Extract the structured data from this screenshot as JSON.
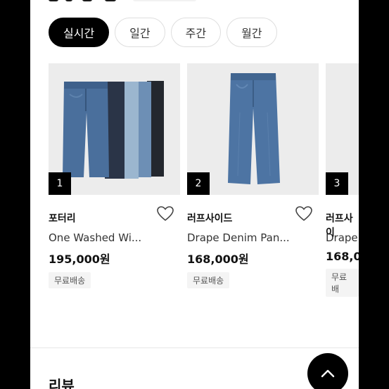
{
  "tabs": [
    {
      "label": "실시간",
      "active": true
    },
    {
      "label": "일간",
      "active": false
    },
    {
      "label": "주간",
      "active": false
    },
    {
      "label": "월간",
      "active": false
    }
  ],
  "products": [
    {
      "rank": "1",
      "brand": "포터리",
      "name": "One Washed Wi...",
      "price": "195,000원",
      "tag": "무료배송"
    },
    {
      "rank": "2",
      "brand": "러프사이드",
      "name": "Drape Denim Pan...",
      "price": "168,000원",
      "tag": "무료배송"
    },
    {
      "rank": "3",
      "brand": "러프사이",
      "name": "Drape",
      "price": "168,0",
      "tag": "무료배"
    }
  ],
  "review_section": {
    "title": "리뷰"
  },
  "icons": {
    "heart": "heart-icon",
    "scroll_top": "chevron-up-icon"
  },
  "colors": {
    "accent": "#000000",
    "chip_border": "#dedede",
    "thumb_bg": "#ececec",
    "tag_bg": "#f4f4f4"
  }
}
